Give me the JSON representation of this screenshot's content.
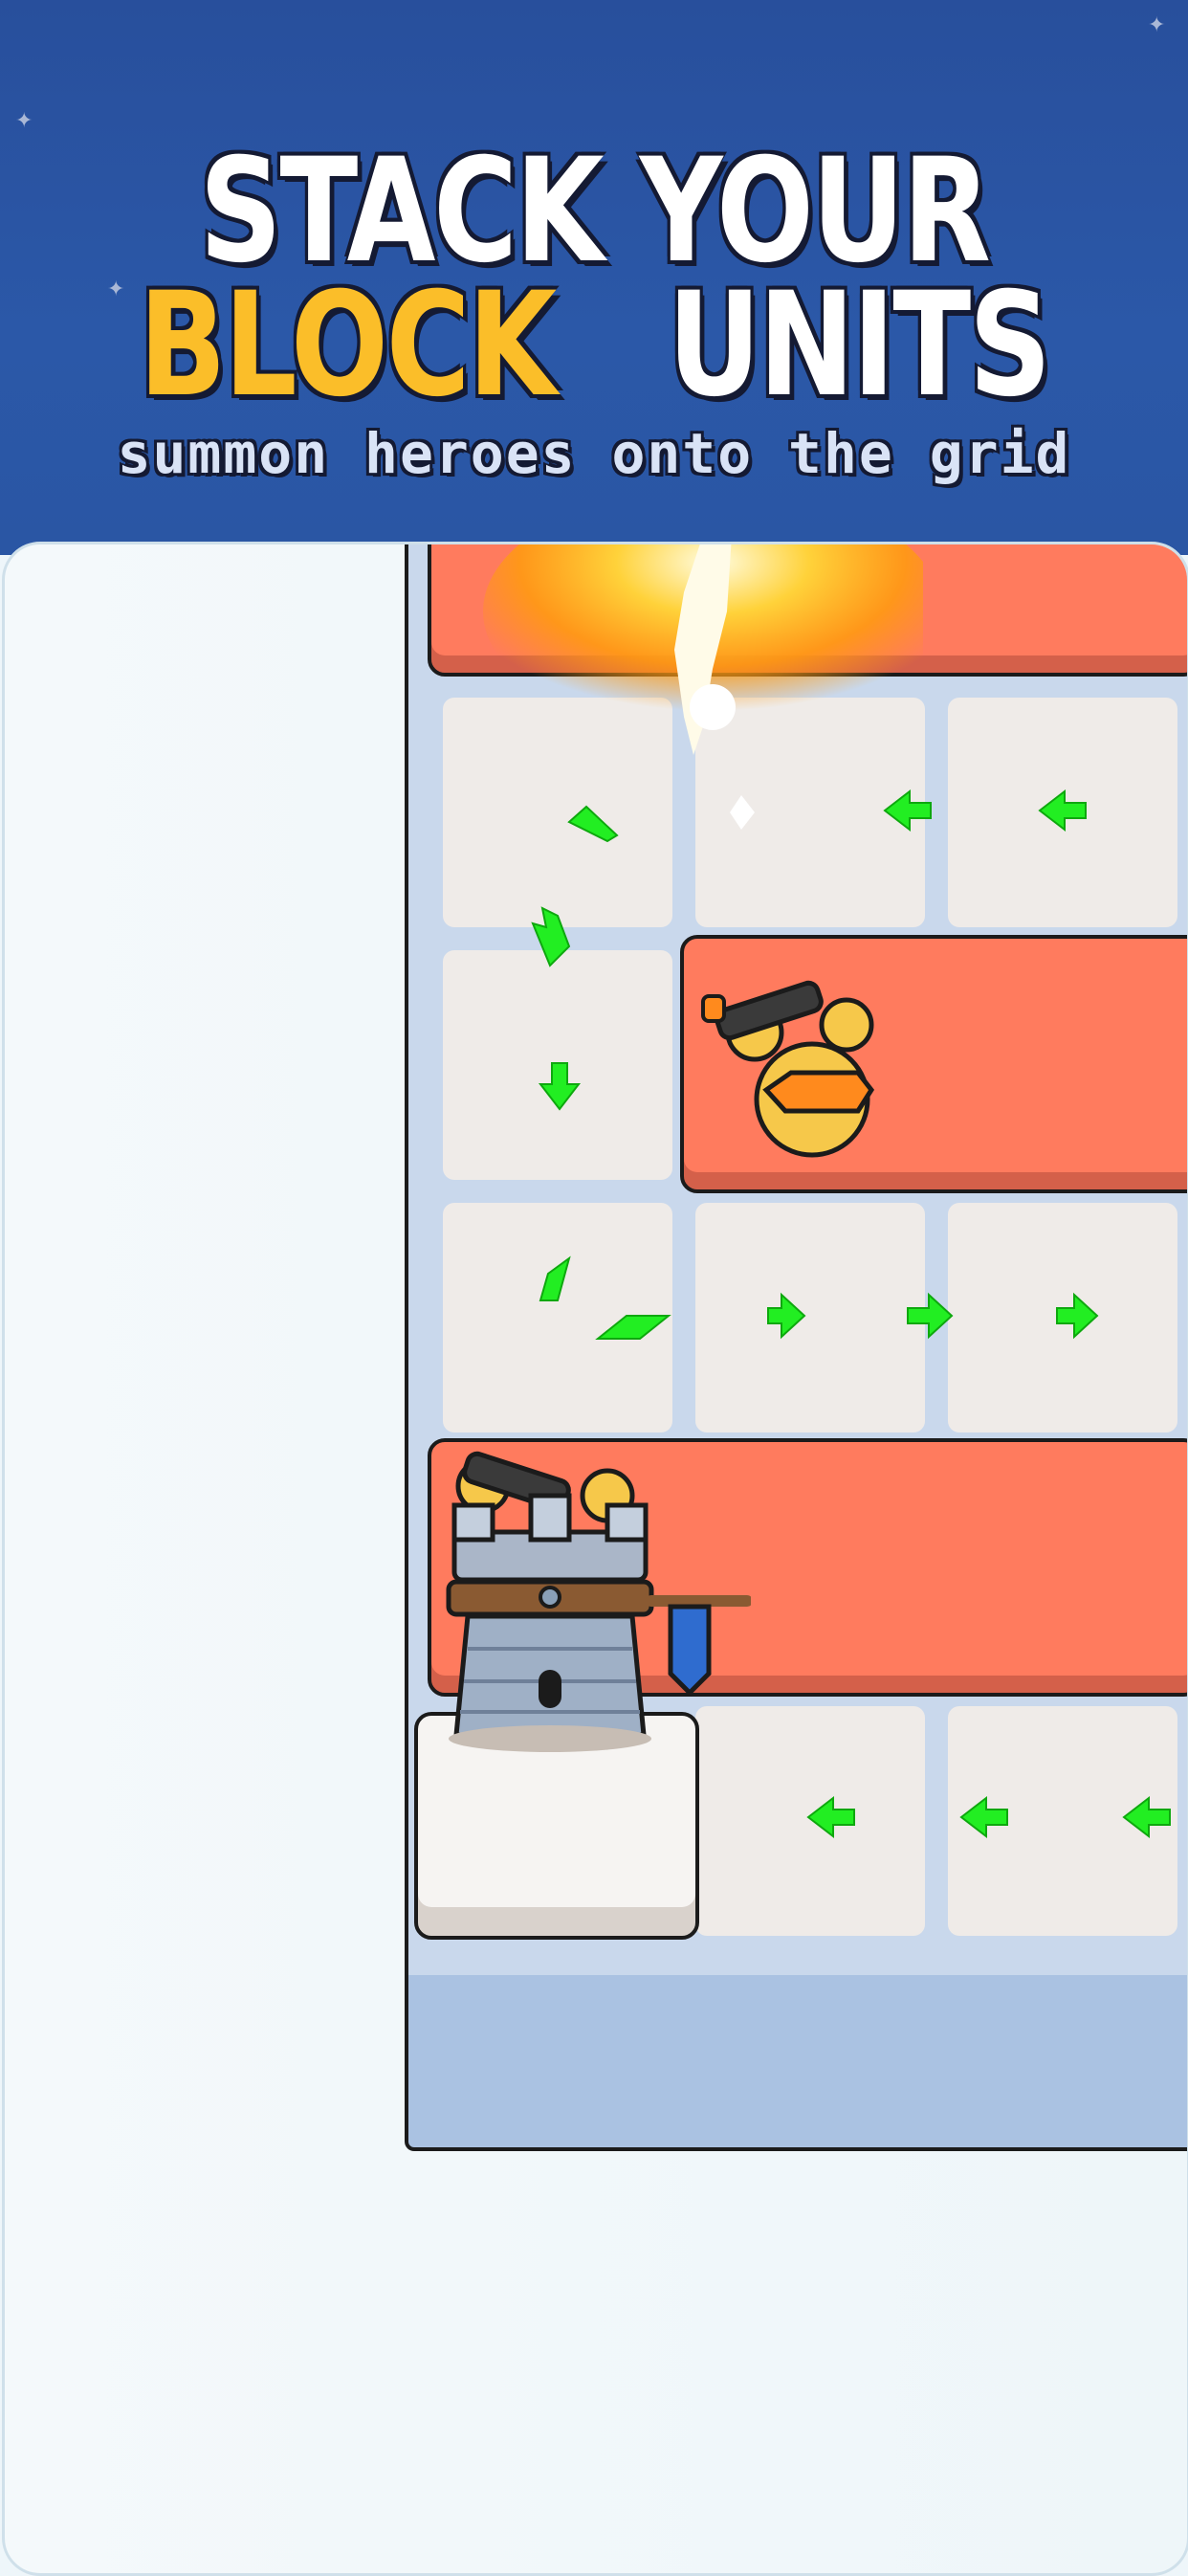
{
  "header": {
    "line1": "STACK YOUR",
    "line2_highlight": "BLOCK",
    "line2_rest": "UNITS",
    "subtitle": "summon heroes onto the grid"
  },
  "colors": {
    "banner": "#2a56a4",
    "highlight": "#fbbe29",
    "block": "#ff7b5e",
    "cell": "#efebe8",
    "board": "#c9d8ec",
    "arrow": "#22ee22"
  },
  "icons": [
    "star-icon",
    "arrow-left-icon",
    "arrow-right-icon",
    "arrow-down-icon",
    "tower-icon",
    "cannon-hero-icon",
    "flame-icon",
    "banner-flag-icon"
  ]
}
